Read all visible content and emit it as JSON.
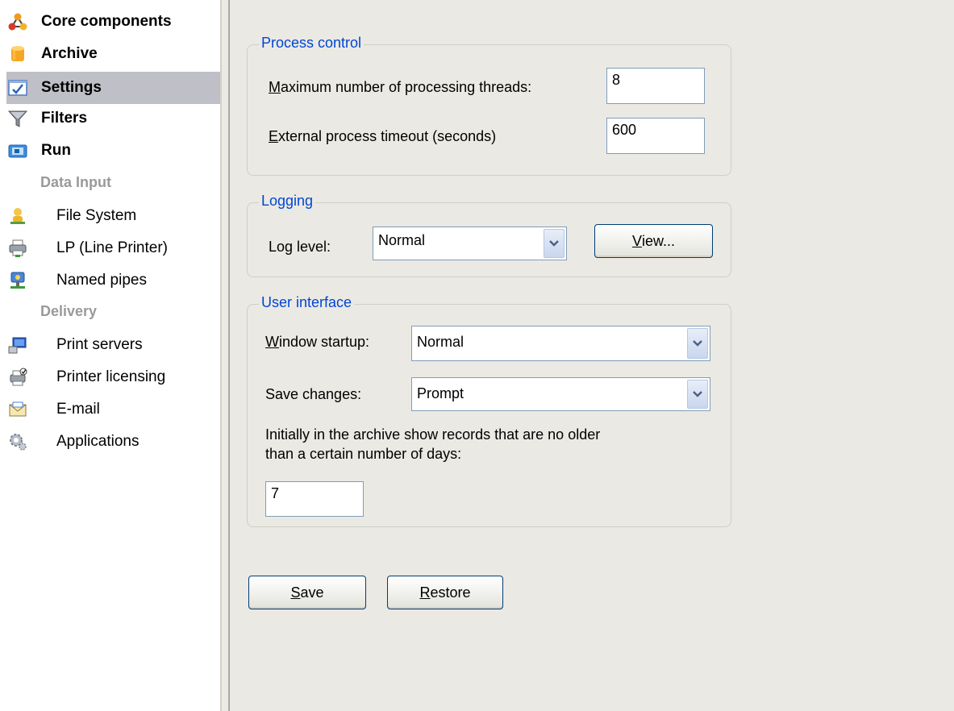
{
  "sidebar": {
    "items": [
      {
        "label": "Core components",
        "icon": "network-nodes-icon"
      },
      {
        "label": "Archive",
        "icon": "database-cylinder-icon"
      },
      {
        "label": "Settings",
        "icon": "checkmark-settings-icon"
      },
      {
        "label": "Filters",
        "icon": "funnel-icon"
      },
      {
        "label": "Run",
        "icon": "run-window-icon"
      }
    ],
    "data_input_heading": "Data Input",
    "data_input_items": [
      {
        "label": "File System",
        "icon": "file-system-user-icon"
      },
      {
        "label": "LP (Line Printer)",
        "icon": "line-printer-icon"
      },
      {
        "label": "Named pipes",
        "icon": "named-pipes-icon"
      }
    ],
    "delivery_heading": "Delivery",
    "delivery_items": [
      {
        "label": "Print servers",
        "icon": "print-server-icon"
      },
      {
        "label": "Printer licensing",
        "icon": "printer-licensing-icon"
      },
      {
        "label": "E-mail",
        "icon": "email-envelope-icon"
      },
      {
        "label": "Applications",
        "icon": "applications-gear-icon"
      }
    ],
    "selected": "Settings"
  },
  "process_control": {
    "title": "Process control",
    "max_threads_label_first": "M",
    "max_threads_label_rest": "aximum number of processing threads:",
    "max_threads_value": "8",
    "timeout_label_first": "E",
    "timeout_label_rest": "xternal process timeout (seconds)",
    "timeout_value": "600"
  },
  "logging": {
    "title": "Logging",
    "log_level_label": "Log level:",
    "log_level_value": "Normal",
    "view_button_first": "V",
    "view_button_rest": "iew..."
  },
  "user_interface": {
    "title": "User interface",
    "window_startup_label_first": "W",
    "window_startup_label_rest": "indow startup:",
    "window_startup_value": "Normal",
    "save_changes_label": "Save changes:",
    "save_changes_value": "Prompt",
    "archive_days_text_line1": "Initially in the archive show records that are no older",
    "archive_days_text_line2": "than a certain number of days:",
    "archive_days_value": "7"
  },
  "buttons": {
    "save_first": "S",
    "save_rest": "ave",
    "restore_first": "R",
    "restore_rest": "estore"
  },
  "colors": {
    "accent": "#0046d5",
    "selection": "#bfbfc7",
    "panel": "#ebe9e3"
  }
}
